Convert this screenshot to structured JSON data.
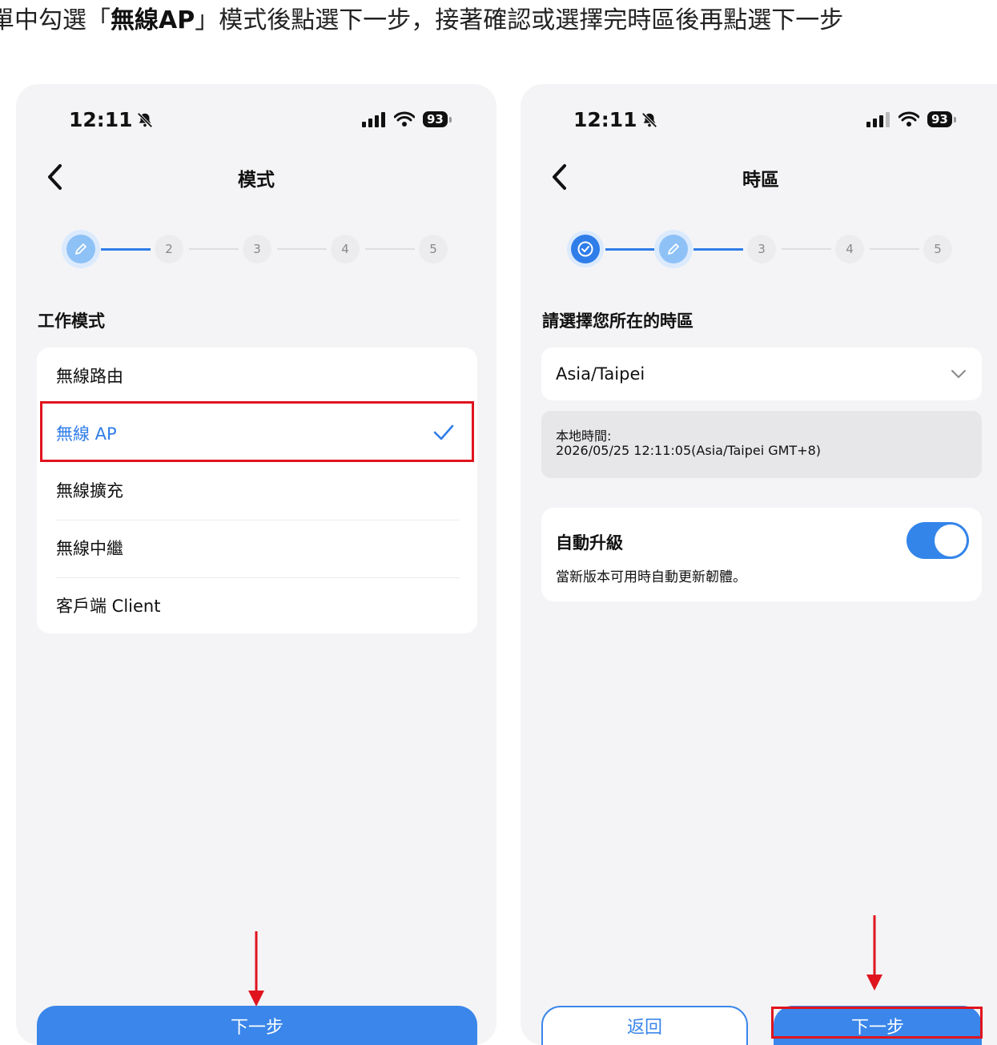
{
  "instruction": {
    "prefix": "單中勾選「",
    "highlight": "無線AP",
    "suffix": "」模式後點選下一步，接著確認或選擇完時區後再點選下一步"
  },
  "colors": {
    "accent": "#2f7de8",
    "annotation_red": "#e0141e"
  },
  "left_phone": {
    "status": {
      "time": "12:11",
      "battery": "93"
    },
    "title": "模式",
    "steps": [
      "2",
      "3",
      "4",
      "5"
    ],
    "section_label": "工作模式",
    "modes": [
      "無線路由",
      "無線 AP",
      "無線擴充",
      "無線中繼",
      "客戶端 Client"
    ],
    "selected_mode": "無線 AP",
    "next_button": "下一步"
  },
  "right_phone": {
    "status": {
      "time": "12:11",
      "battery": "93"
    },
    "title": "時區",
    "steps": [
      "3",
      "4",
      "5"
    ],
    "section_label": "請選擇您所在的時區",
    "timezone": "Asia/Taipei",
    "local_time_label": "本地時間:",
    "local_time_value": "2026/05/25 12:11:05(Asia/Taipei GMT+8)",
    "auto_upgrade": {
      "title": "自動升級",
      "description": "當新版本可用時自動更新韌體。",
      "enabled": true
    },
    "back_button": "返回",
    "next_button": "下一步"
  }
}
